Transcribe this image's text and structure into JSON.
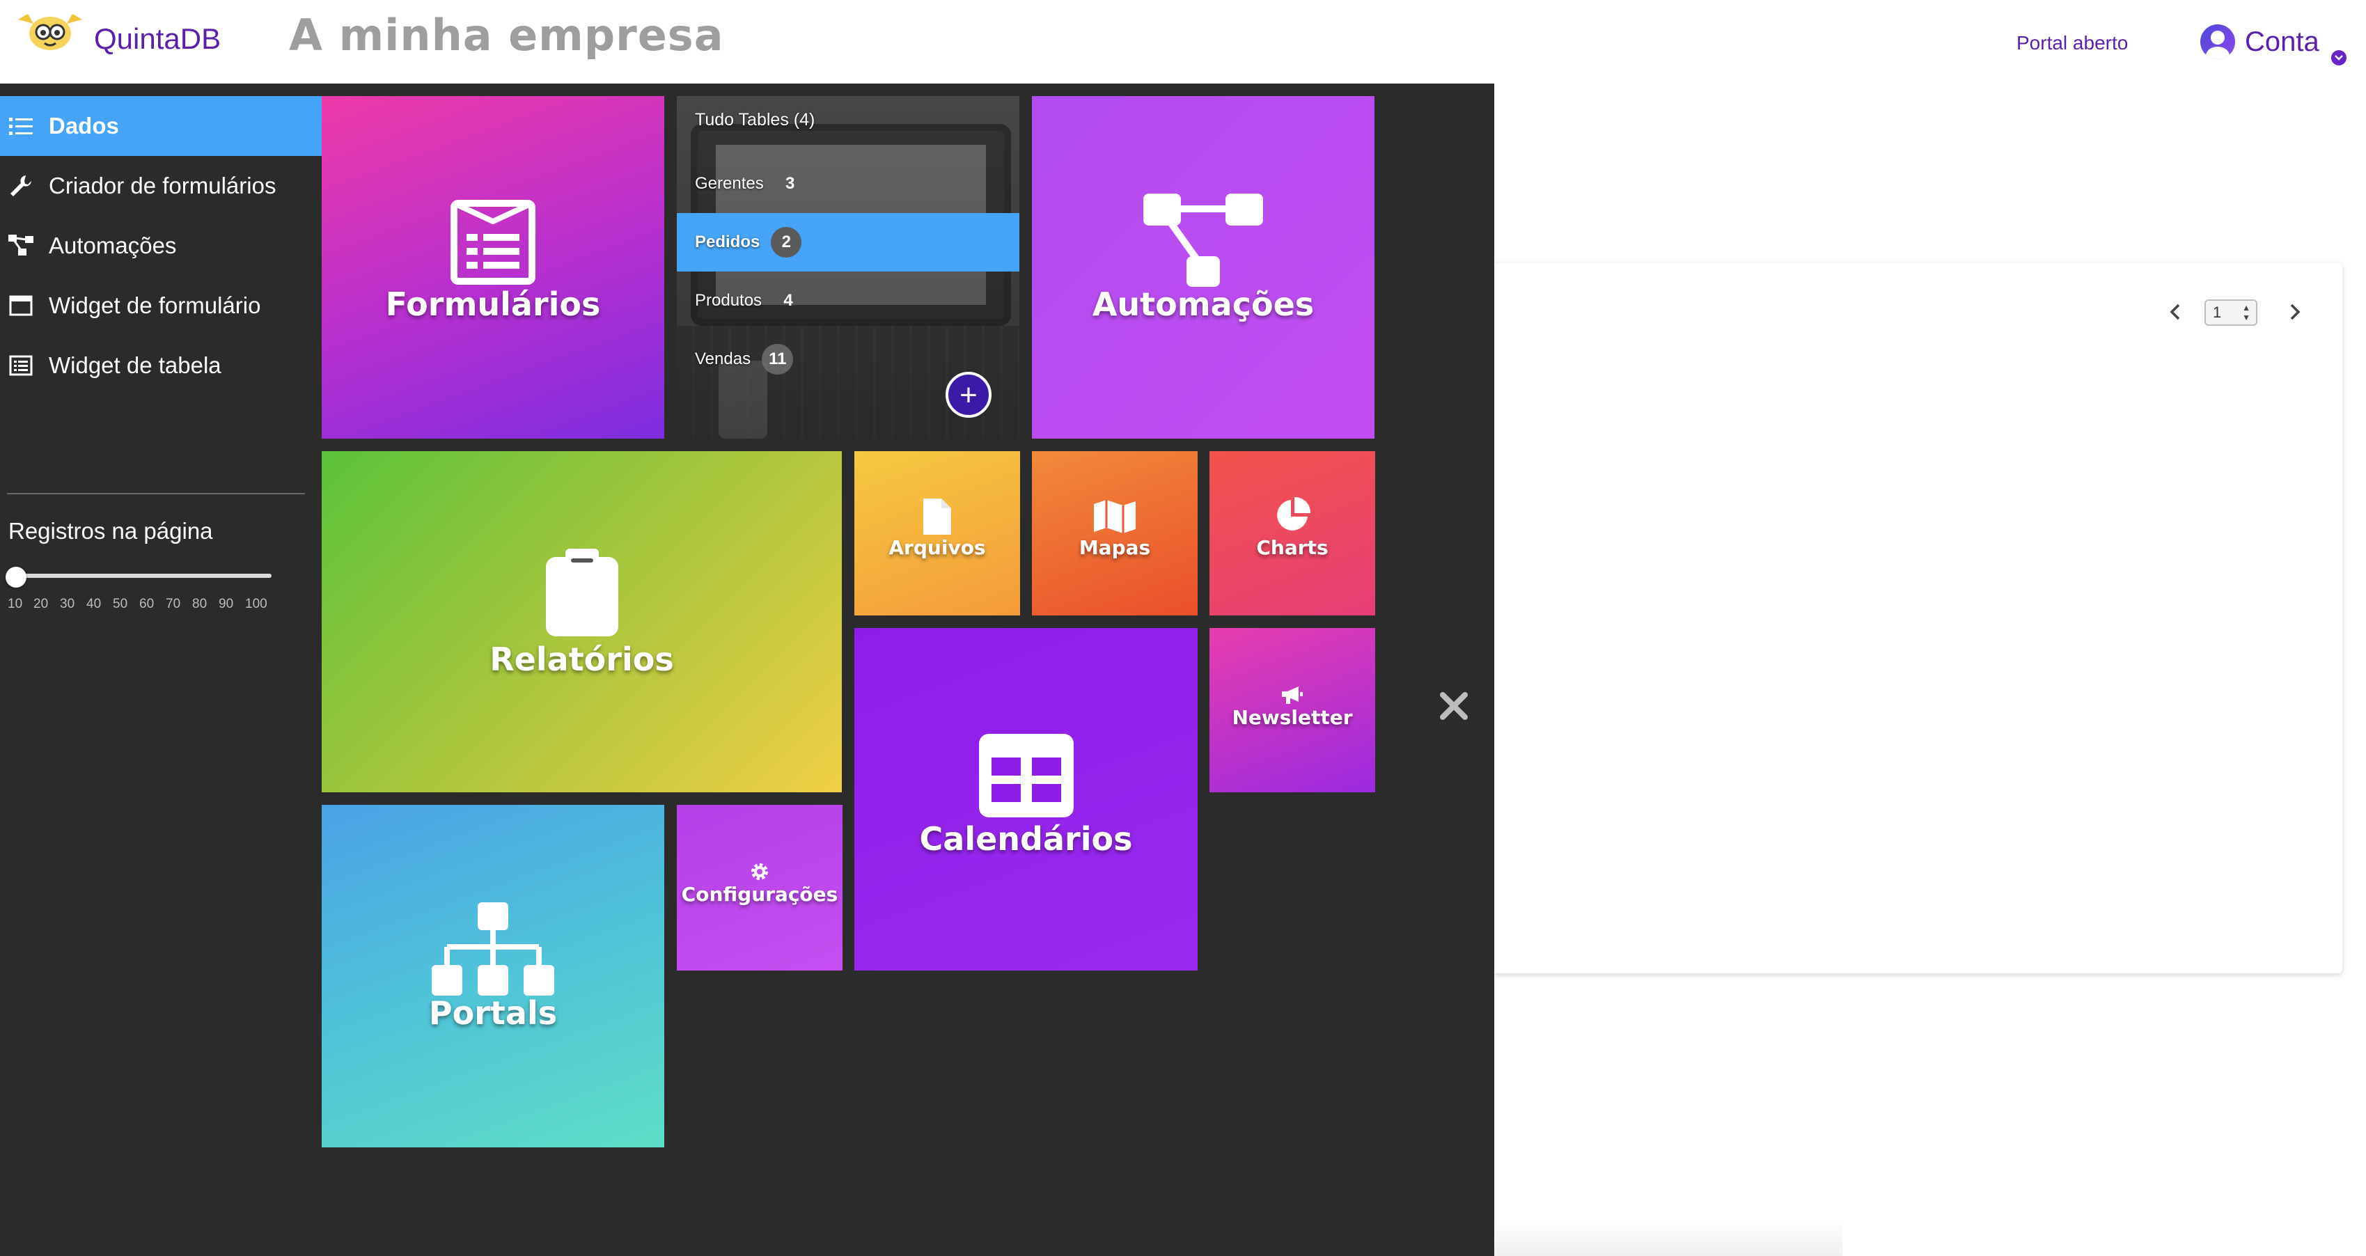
{
  "header": {
    "brand": "QuintaDB",
    "company": "A minha empresa",
    "portal_link": "Portal aberto",
    "account_label": "Conta",
    "accent_color": "#5b1fae"
  },
  "sidebar": {
    "items": [
      {
        "label": "Dados",
        "icon": "list-icon",
        "active": true
      },
      {
        "label": "Criador de formulários",
        "icon": "wrench-icon"
      },
      {
        "label": "Automações",
        "icon": "automation-icon"
      },
      {
        "label": "Widget de formulário",
        "icon": "window-icon"
      },
      {
        "label": "Widget de tabela",
        "icon": "table-list-icon"
      }
    ],
    "records_title": "Registros na página",
    "records_value": 10,
    "slider_ticks": [
      "10",
      "20",
      "30",
      "40",
      "50",
      "60",
      "70",
      "80",
      "90",
      "100"
    ]
  },
  "tables_tile": {
    "all_label": "Tudo Tables (4)",
    "tables": [
      {
        "name": "Gerentes",
        "count": "3"
      },
      {
        "name": "Pedidos",
        "count": "2",
        "active": true
      },
      {
        "name": "Produtos",
        "count": "4"
      },
      {
        "name": "Vendas",
        "count": "11"
      }
    ],
    "add_label": "+"
  },
  "tiles": {
    "forms": "Formulários",
    "automations": "Automações",
    "reports": "Relatórios",
    "files": "Arquivos",
    "maps": "Mapas",
    "charts": "Charts",
    "calendars": "Calendários",
    "newsletter": "Newsletter",
    "portals": "Portals",
    "settings": "Configurações"
  },
  "pagination": {
    "current_page": "1"
  },
  "colors": {
    "panel_bg": "#2b2b2b",
    "active_blue": "#45a4f7"
  }
}
